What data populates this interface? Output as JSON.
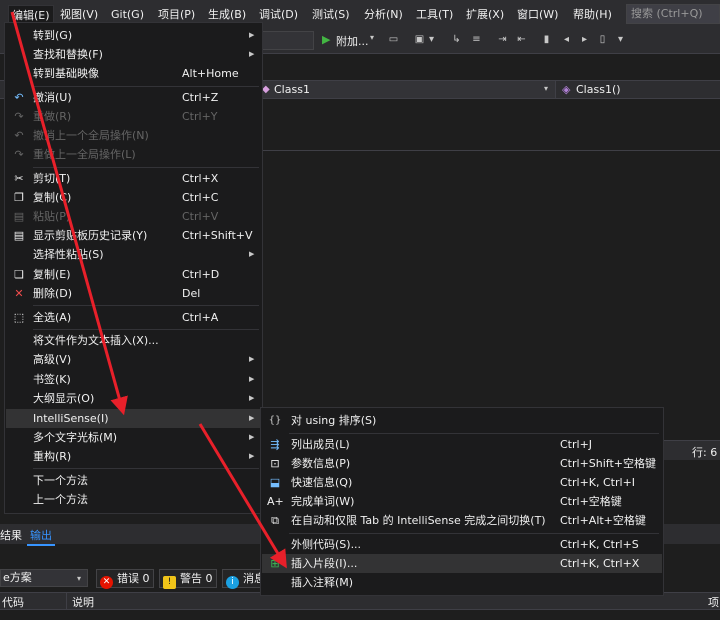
{
  "menubar": {
    "items": [
      "编辑(E)",
      "视图(V)",
      "Git(G)",
      "项目(P)",
      "生成(B)",
      "调试(D)",
      "测试(S)",
      "分析(N)",
      "工具(T)",
      "扩展(X)",
      "窗口(W)",
      "帮助(H)"
    ],
    "search_placeholder": "搜索 (Ctrl+Q)"
  },
  "toolbar": {
    "attach_label": "附加...",
    "dropdown_glyph": "▾"
  },
  "navbar": {
    "class_name": "Class1",
    "member_name": "Class1()"
  },
  "status": {
    "row_label": "行: 6"
  },
  "bottom_panel": {
    "tab_results": "结果",
    "tab_output": "输出",
    "filter_value": "e方案",
    "errors_label": "错误 0",
    "warnings_label": "警告 0",
    "messages_label": "消息",
    "col_code": "代码",
    "col_desc": "说明",
    "col_proj": "项"
  },
  "edit_menu": {
    "items": [
      {
        "label": "转到(G)",
        "shortcut": "",
        "submenu": true
      },
      {
        "label": "查找和替换(F)",
        "shortcut": "",
        "submenu": true
      },
      {
        "label": "转到基础映像",
        "shortcut": "Alt+Home"
      },
      {
        "label": "撤消(U)",
        "shortcut": "Ctrl+Z",
        "icon": "undo-icon"
      },
      {
        "label": "重做(R)",
        "shortcut": "Ctrl+Y",
        "icon": "redo-icon",
        "disabled": true
      },
      {
        "label": "撤消上一个全局操作(N)",
        "shortcut": "",
        "icon": "global-undo-icon",
        "disabled": true
      },
      {
        "label": "重做上一全局操作(L)",
        "shortcut": "",
        "icon": "global-redo-icon",
        "disabled": true
      },
      {
        "label": "剪切(T)",
        "shortcut": "Ctrl+X",
        "icon": "scissors-icon"
      },
      {
        "label": "复制(C)",
        "shortcut": "Ctrl+C",
        "icon": "copy-icon"
      },
      {
        "label": "粘贴(P)",
        "shortcut": "Ctrl+V",
        "icon": "paste-icon",
        "disabled": true
      },
      {
        "label": "显示剪贴板历史记录(Y)",
        "shortcut": "Ctrl+Shift+V",
        "icon": "clipboard-icon"
      },
      {
        "label": "选择性粘贴(S)",
        "shortcut": "",
        "submenu": true
      },
      {
        "label": "复制(E)",
        "shortcut": "Ctrl+D",
        "icon": "duplicate-icon"
      },
      {
        "label": "删除(D)",
        "shortcut": "Del",
        "icon": "delete-icon"
      },
      {
        "label": "全选(A)",
        "shortcut": "Ctrl+A",
        "icon": "select-all-icon"
      },
      {
        "label": "将文件作为文本插入(X)...",
        "shortcut": ""
      },
      {
        "label": "高级(V)",
        "shortcut": "",
        "submenu": true
      },
      {
        "label": "书签(K)",
        "shortcut": "",
        "submenu": true
      },
      {
        "label": "大纲显示(O)",
        "shortcut": "",
        "submenu": true
      },
      {
        "label": "IntelliSense(I)",
        "shortcut": "",
        "submenu": true,
        "highlighted": true
      },
      {
        "label": "多个文字光标(M)",
        "shortcut": "",
        "submenu": true
      },
      {
        "label": "重构(R)",
        "shortcut": "",
        "submenu": true
      },
      {
        "label": "下一个方法",
        "shortcut": ""
      },
      {
        "label": "上一个方法",
        "shortcut": ""
      }
    ],
    "submenu_glyph": "▶"
  },
  "intellisense_menu": {
    "items": [
      {
        "label": "对 using 排序(S)",
        "shortcut": "",
        "icon": "sort-usings-icon"
      },
      {
        "label": "列出成员(L)",
        "shortcut": "Ctrl+J",
        "icon": "list-members-icon"
      },
      {
        "label": "参数信息(P)",
        "shortcut": "Ctrl+Shift+空格键",
        "icon": "parameter-info-icon"
      },
      {
        "label": "快速信息(Q)",
        "shortcut": "Ctrl+K, Ctrl+I",
        "icon": "quick-info-icon"
      },
      {
        "label": "完成单词(W)",
        "shortcut": "Ctrl+空格键",
        "icon": "complete-word-icon"
      },
      {
        "label": "在自动和仅限 Tab 的 IntelliSense 完成之间切换(T)",
        "shortcut": "Ctrl+Alt+空格键",
        "icon": "toggle-completion-icon"
      },
      {
        "label": "外侧代码(S)...",
        "shortcut": "Ctrl+K, Ctrl+S",
        "icon": ""
      },
      {
        "label": "插入片段(I)...",
        "shortcut": "Ctrl+K, Ctrl+X",
        "icon": "insert-snippet-icon",
        "highlighted": true
      },
      {
        "label": "插入注释(M)",
        "shortcut": "",
        "icon": ""
      }
    ]
  },
  "colors": {
    "menu_bg": "#1b1b1c",
    "highlight": "#333334",
    "accent_blue": "#3794ff",
    "arrow_red": "#e8202a",
    "error_red": "#e51400",
    "warning_yellow": "#f0c419"
  }
}
